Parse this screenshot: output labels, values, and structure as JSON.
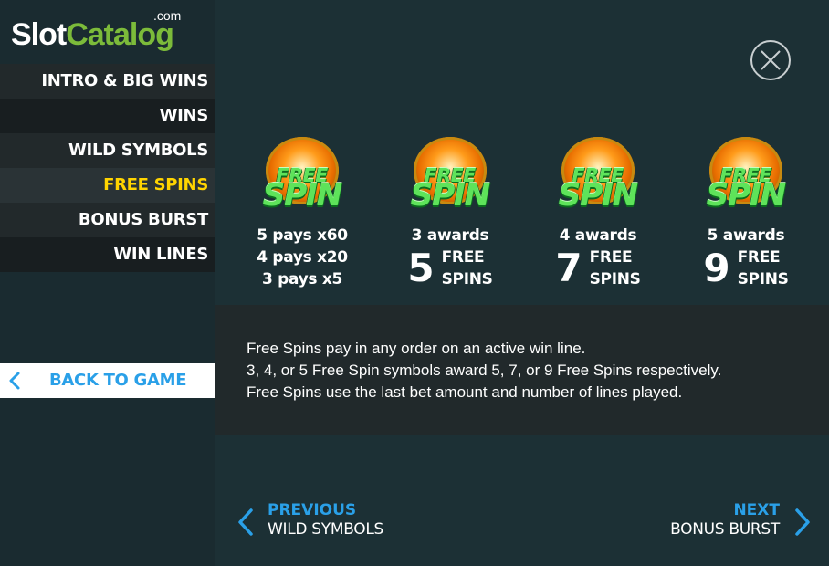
{
  "logo": {
    "part1": "Slot",
    "part2": "Catalog",
    "suffix": ".com"
  },
  "menu": {
    "items": [
      {
        "label": "INTRO & BIG WINS"
      },
      {
        "label": "WINS"
      },
      {
        "label": "WILD SYMBOLS"
      },
      {
        "label": "FREE SPINS",
        "active": true
      },
      {
        "label": "BONUS BURST"
      },
      {
        "label": "WIN LINES"
      }
    ],
    "back_label": "BACK TO GAME"
  },
  "symbol_text": {
    "free": "FREE",
    "spin": "SPIN"
  },
  "symbols": [
    {
      "lines": [
        "5 pays x60",
        "4 pays x20",
        "3 pays x5"
      ]
    },
    {
      "awards_label": "3 awards",
      "number": "5",
      "text1": "FREE",
      "text2": "SPINS"
    },
    {
      "awards_label": "4 awards",
      "number": "7",
      "text1": "FREE",
      "text2": "SPINS"
    },
    {
      "awards_label": "5 awards",
      "number": "9",
      "text1": "FREE",
      "text2": "SPINS"
    }
  ],
  "description": [
    "Free Spins pay in any order on an active win line.",
    "3, 4, or 5 Free Spin symbols award 5, 7, or 9 Free Spins respectively.",
    "Free Spins use the last bet amount and number of lines played."
  ],
  "nav": {
    "prev_label": "PREVIOUS",
    "prev_name": "WILD SYMBOLS",
    "next_label": "NEXT",
    "next_name": "BONUS BURST"
  },
  "icons": {
    "close": "close-icon",
    "back": "chevron-left-icon",
    "prev": "chevron-left-icon",
    "next": "chevron-right-icon",
    "symbol": "free-spin-coin-icon"
  },
  "colors": {
    "accent_blue": "#2aa0e8",
    "active_yellow": "#ffd400",
    "logo_green": "#7cbb3a",
    "symbol_green": "#5ee35a"
  }
}
